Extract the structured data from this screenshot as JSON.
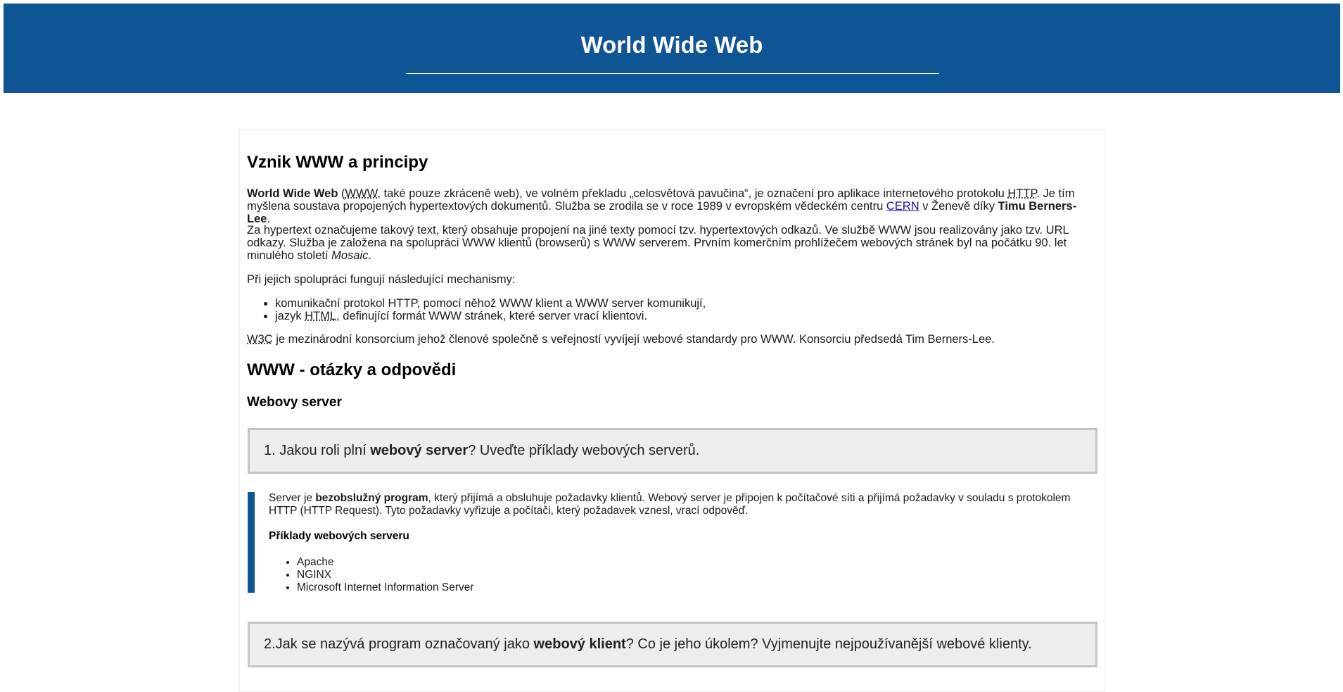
{
  "header": {
    "title": "World Wide Web"
  },
  "section1": {
    "heading": "Vznik WWW a principy",
    "p1": {
      "bold_title": "World Wide Web",
      "t1": " (",
      "abbr_www": "WWW",
      "t2": ", také pouze zkráceně web), ve volném překladu „celosvětová pavučina“, je označení pro aplikace internetového protokolu ",
      "abbr_http": "HTTP",
      "t3": ". Je tím myšlena soustava propojených hypertextových dokumentů. Služba se zrodila se v roce 1989 v evropském vědeckém centru ",
      "link_cern": "CERN",
      "t4": " v Ženevě díky ",
      "bold_name": "Timu Berners-Lee",
      "t5": "."
    },
    "p2": {
      "text": "Za hypertext označujeme takový text, který obsahuje propojení na jiné texty pomocí tzv. hypertextových odkazů. Ve službě WWW jsou realizovány jako tzv. URL odkazy. Služba je založena na spolupráci WWW klientů (browserů) s WWW serverem. Prvním komerčním prohlížečem webových stránek byl na počátku 90. let minulého století ",
      "italic": "Mosaic",
      "end": "."
    },
    "p3": "Při jejich spolupráci fungují následující mechanismy:",
    "list": {
      "item1": "komunikační protokol HTTP, pomocí něhož WWW klient a WWW server komunikují,",
      "item2_pre": "jazyk ",
      "item2_abbr": "HTML",
      "item2_post": ", definující formát WWW stránek, které server vrací klientovi."
    },
    "p4": {
      "abbr": "W3C",
      "text": " je mezinárodní konsorcium jehož členové společně s veřejností vyvíjejí webové standardy pro WWW. Konsorciu předsedá Tim Berners-Lee."
    }
  },
  "section2": {
    "heading": "WWW - otázky a odpovědi",
    "subheading": "Webovy server",
    "q1": {
      "pre": "1. Jakou roli plní ",
      "bold": "webový server",
      "post": "? Uveďte příklady webových serverů."
    },
    "a1": {
      "pre": "Server je ",
      "bold": "bezobslužný program",
      "post": ", který přijímá a obsluhuje požadavky klientů. Webový server je připojen k počítačové síti a přijímá požadavky v souladu s protokolem HTTP (HTTP Request). Tyto požadavky vyřizuje a počítači, který požadavek vznesl, vrací odpověď.",
      "examples_heading": "Příklady webových serveru",
      "examples": [
        "Apache",
        "NGINX",
        "Microsoft Internet Information Server"
      ]
    },
    "q2": {
      "pre": "2.Jak se nazývá program označovaný jako ",
      "bold": "webový klient",
      "post": "? Co je jeho úkolem? Vyjmenujte nejpoužívanější webové klienty."
    }
  }
}
